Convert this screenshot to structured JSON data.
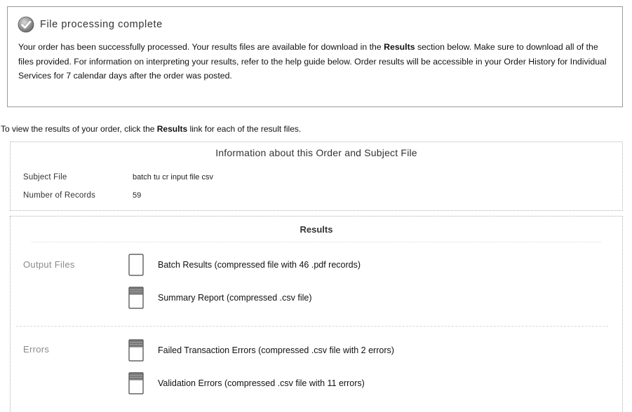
{
  "notice": {
    "title": "File processing complete",
    "icon": "checkmark-circle-icon",
    "body_part1": "Your order has been successfully processed. Your results files are available for download in the ",
    "body_bold": "Results",
    "body_part2": " section below. Make sure to download all of the files provided. For information on interpreting your results, refer to the help guide below. Order results will be accessible in your Order History for Individual Services for 7 calendar days after the order was posted."
  },
  "instruction": {
    "part1": "To view the results of your order, click the ",
    "bold": "Results",
    "part2": " link for each of the result files."
  },
  "order_info": {
    "title": "Information about this Order and Subject File",
    "subject_file_label": "Subject File",
    "subject_file_value": "batch tu cr input file csv",
    "records_label": "Number of Records",
    "records_value": "59"
  },
  "results": {
    "title": "Results",
    "output_label": "Output Files",
    "errors_label": "Errors",
    "output_files": [
      {
        "label": "Batch Results (compressed file with 46 .pdf records)",
        "icon": "document-icon"
      },
      {
        "label": "Summary Report (compressed .csv file)",
        "icon": "spreadsheet-icon"
      }
    ],
    "error_files": [
      {
        "label": "Failed Transaction Errors (compressed .csv file with 2 errors)",
        "icon": "spreadsheet-icon"
      },
      {
        "label": "Validation Errors (compressed .csv file with 11 errors)",
        "icon": "spreadsheet-icon"
      }
    ]
  }
}
